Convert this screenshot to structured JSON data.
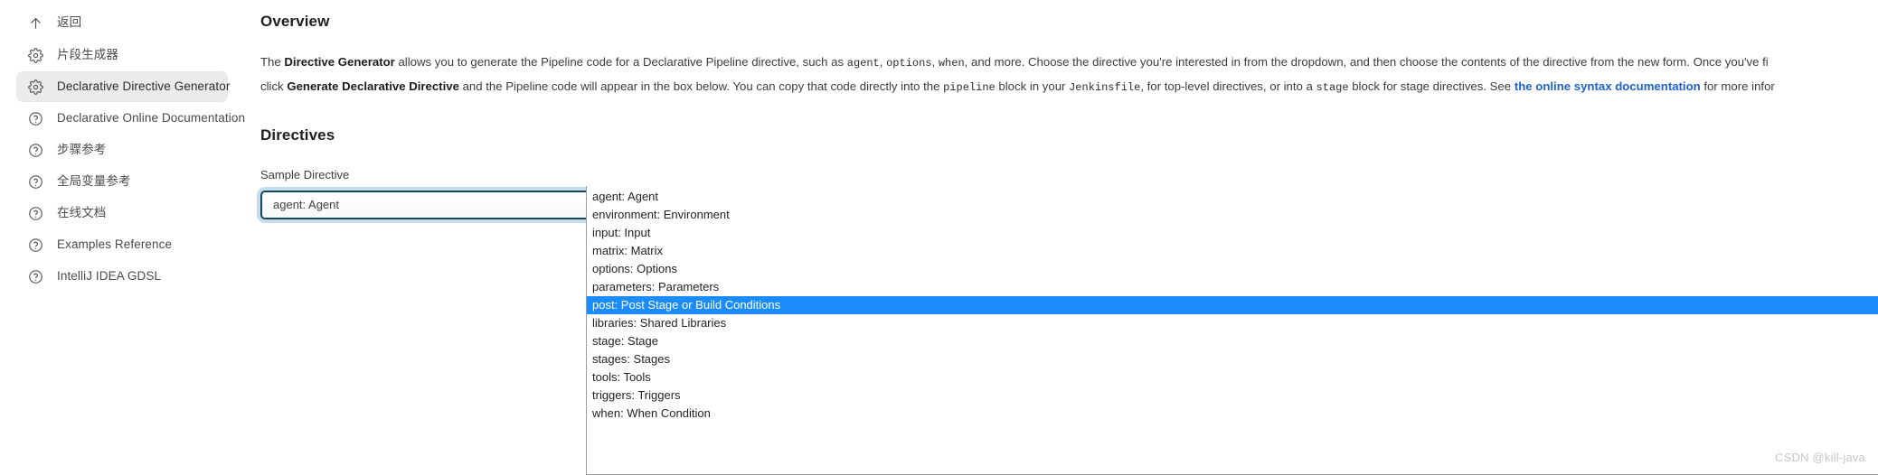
{
  "sidebar": {
    "items": [
      {
        "label": "返回",
        "icon": "arrow-up-icon",
        "active": false
      },
      {
        "label": "片段生成器",
        "icon": "gear-icon",
        "active": false
      },
      {
        "label": "Declarative Directive Generator",
        "icon": "gear-icon",
        "active": true
      },
      {
        "label": "Declarative Online Documentation",
        "icon": "question-circle-icon",
        "active": false
      },
      {
        "label": "步骤参考",
        "icon": "question-circle-icon",
        "active": false
      },
      {
        "label": "全局变量参考",
        "icon": "question-circle-icon",
        "active": false
      },
      {
        "label": "在线文档",
        "icon": "question-circle-icon",
        "active": false
      },
      {
        "label": "Examples Reference",
        "icon": "question-circle-icon",
        "active": false
      },
      {
        "label": "IntelliJ IDEA GDSL",
        "icon": "question-circle-icon",
        "active": false
      }
    ]
  },
  "main": {
    "overview_title": "Overview",
    "paragraph": {
      "line1": {
        "t1": "The ",
        "b1": "Directive Generator",
        "t2": " allows you to generate the Pipeline code for a Declarative Pipeline directive, such as ",
        "c1": "agent",
        "t3": ", ",
        "c2": "options",
        "t4": ", ",
        "c3": "when",
        "t5": ", and more. Choose the directive you're interested in from the dropdown, and then choose the contents of the directive from the new form. Once you've fi"
      },
      "line2": {
        "t1": "click ",
        "b1": "Generate Declarative Directive",
        "t2": " and the Pipeline code will appear in the box below. You can copy that code directly into the ",
        "c1": "pipeline",
        "t3": " block in your ",
        "c2": "Jenkinsfile",
        "t4": ", for top-level directives, or into a ",
        "c3": "stage",
        "t5": " block for stage directives. See ",
        "link": "the online syntax documentation",
        "t6": " for more infor"
      }
    },
    "directives_title": "Directives",
    "sample_directive_label": "Sample Directive",
    "select": {
      "value": "agent: Agent",
      "chevron_icon": "chevron-down-icon",
      "options": [
        {
          "label": "agent: Agent",
          "selected": false
        },
        {
          "label": "environment: Environment",
          "selected": false
        },
        {
          "label": "input: Input",
          "selected": false
        },
        {
          "label": "matrix: Matrix",
          "selected": false
        },
        {
          "label": "options: Options",
          "selected": false
        },
        {
          "label": "parameters: Parameters",
          "selected": false
        },
        {
          "label": "post: Post Stage or Build Conditions",
          "selected": true
        },
        {
          "label": "libraries: Shared Libraries",
          "selected": false
        },
        {
          "label": "stage: Stage",
          "selected": false
        },
        {
          "label": "stages: Stages",
          "selected": false
        },
        {
          "label": "tools: Tools",
          "selected": false
        },
        {
          "label": "triggers: Triggers",
          "selected": false
        },
        {
          "label": "when: When Condition",
          "selected": false
        }
      ]
    },
    "secondary_select": {
      "chevron_icon": "chevron-down-icon"
    }
  },
  "watermark": {
    "text": "CSDN @kill-java"
  },
  "colors": {
    "accent_selected": "#1b8cf9",
    "link": "#1f62cf",
    "focus_border": "#12475e",
    "focus_ring": "#c6dceb",
    "sidebar_active_bg": "#ebebeb"
  }
}
